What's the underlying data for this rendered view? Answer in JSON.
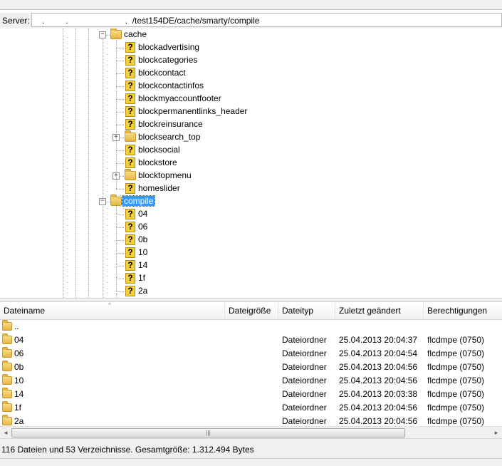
{
  "server": {
    "label": "Server:",
    "path": "   .         .                        .  /test154DE/cache/smarty/compile"
  },
  "tree": {
    "cache_folder": "cache",
    "cache_children": [
      {
        "name": "blockadvertising",
        "type": "unknown",
        "expandable": false
      },
      {
        "name": "blockcategories",
        "type": "unknown",
        "expandable": false
      },
      {
        "name": "blockcontact",
        "type": "unknown",
        "expandable": false
      },
      {
        "name": "blockcontactinfos",
        "type": "unknown",
        "expandable": false
      },
      {
        "name": "blockmyaccountfooter",
        "type": "unknown",
        "expandable": false
      },
      {
        "name": "blockpermanentlinks_header",
        "type": "unknown",
        "expandable": false
      },
      {
        "name": "blockreinsurance",
        "type": "unknown",
        "expandable": false
      },
      {
        "name": "blocksearch_top",
        "type": "folder",
        "expandable": true
      },
      {
        "name": "blocksocial",
        "type": "unknown",
        "expandable": false
      },
      {
        "name": "blockstore",
        "type": "unknown",
        "expandable": false
      },
      {
        "name": "blocktopmenu",
        "type": "folder",
        "expandable": true
      },
      {
        "name": "homeslider",
        "type": "unknown",
        "expandable": false
      }
    ],
    "compile_folder": "compile",
    "compile_children": [
      "04",
      "06",
      "0b",
      "10",
      "14",
      "1f",
      "2a"
    ],
    "collapse_glyph": "−",
    "expand_glyph": "+",
    "unknown_glyph": "?"
  },
  "list": {
    "columns": {
      "name": "Dateiname",
      "size": "Dateigröße",
      "type": "Dateityp",
      "modified": "Zuletzt geändert",
      "perms": "Berechtigungen"
    },
    "sort_glyph": "^",
    "rows": [
      {
        "name": "..",
        "type": "",
        "modified": "",
        "perms": ""
      },
      {
        "name": "04",
        "type": "Dateiordner",
        "modified": "25.04.2013 20:04:37",
        "perms": "flcdmpe (0750)"
      },
      {
        "name": "06",
        "type": "Dateiordner",
        "modified": "25.04.2013 20:04:54",
        "perms": "flcdmpe (0750)"
      },
      {
        "name": "0b",
        "type": "Dateiordner",
        "modified": "25.04.2013 20:04:56",
        "perms": "flcdmpe (0750)"
      },
      {
        "name": "10",
        "type": "Dateiordner",
        "modified": "25.04.2013 20:04:56",
        "perms": "flcdmpe (0750)"
      },
      {
        "name": "14",
        "type": "Dateiordner",
        "modified": "25.04.2013 20:03:38",
        "perms": "flcdmpe (0750)"
      },
      {
        "name": "1f",
        "type": "Dateiordner",
        "modified": "25.04.2013 20:04:56",
        "perms": "flcdmpe (0750)"
      },
      {
        "name": "2a",
        "type": "Dateiordner",
        "modified": "25.04.2013 20:04:56",
        "perms": "flcdmpe (0750)"
      }
    ]
  },
  "scrollbar": {
    "left_arrow": "◂",
    "right_arrow": "▸",
    "grip": "|||"
  },
  "status": "116 Dateien und 53 Verzeichnisse. Gesamtgröße: 1.312.494 Bytes"
}
